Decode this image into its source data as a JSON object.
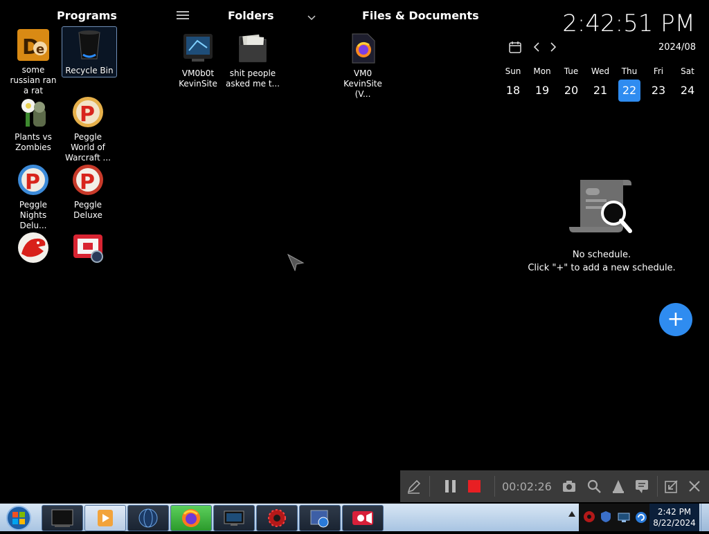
{
  "sections": {
    "programs": "Programs",
    "folders": "Folders",
    "files": "Files & Documents"
  },
  "programs": [
    {
      "label": "some russian ran a rat",
      "icon": "russian-rat-app-icon"
    },
    {
      "label": "Recycle Bin",
      "icon": "recycle-bin-icon"
    },
    {
      "label": "Plants vs Zombies",
      "icon": "plants-vs-zombies-icon"
    },
    {
      "label": "Peggle World of Warcraft ...",
      "icon": "peggle-icon"
    },
    {
      "label": "Peggle Nights Delu...",
      "icon": "peggle-icon"
    },
    {
      "label": "Peggle Deluxe",
      "icon": "peggle-icon"
    },
    {
      "label": "",
      "icon": "dragon-icon"
    },
    {
      "label": "",
      "icon": "media-app-icon"
    }
  ],
  "folders": [
    {
      "label": "VM0b0t KevinSite",
      "icon": "monitor-folder-icon"
    },
    {
      "label": "shit people asked me t...",
      "icon": "folder-icon"
    }
  ],
  "files": [
    {
      "label": "VM0 KevinSite (V...",
      "icon": "firefox-document-icon"
    }
  ],
  "clock": {
    "time": "2:42:51 PM"
  },
  "calendar": {
    "month": "2024/08",
    "weekdays": [
      "Sun",
      "Mon",
      "Tue",
      "Wed",
      "Thu",
      "Fri",
      "Sat"
    ],
    "days": [
      "18",
      "19",
      "20",
      "21",
      "22",
      "23",
      "24"
    ],
    "today": "22"
  },
  "schedule": {
    "empty_title": "No schedule.",
    "empty_hint": "Click \"+\" to add a new schedule.",
    "add_label": "+"
  },
  "recorder": {
    "elapsed": "00:02:26"
  },
  "taskbar": {
    "time": "2:42 PM",
    "date": "8/22/2024"
  },
  "colors": {
    "accent": "#2f8cf0",
    "record_red": "#e81f23",
    "taskbar": "#b7cfe9"
  }
}
